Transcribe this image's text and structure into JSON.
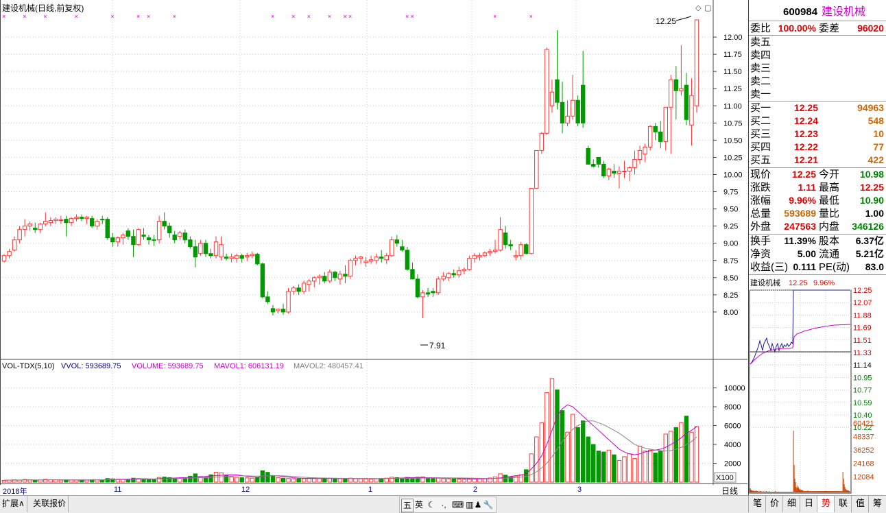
{
  "window": {
    "title": "建设机械(日线,前复权)",
    "right_icons": [
      "◇",
      "▢"
    ]
  },
  "colors": {
    "up": "#ff3232",
    "down": "#009900",
    "vol_label": "#0000ff",
    "volume_label": "#cc00cc",
    "mavol1": "#cc00cc",
    "mavol2": "#808080",
    "bg": "#ffffff",
    "grid": "#c8c8c8"
  },
  "price_axis": {
    "ticks": [
      "12.00",
      "11.75",
      "11.50",
      "11.25",
      "11.00",
      "10.75",
      "10.50",
      "10.25",
      "10.00",
      "9.75",
      "9.50",
      "9.25",
      "9.00",
      "8.75",
      "8.50",
      "8.25",
      "8.00"
    ]
  },
  "annotations": {
    "max_label": "12.25",
    "min_label": "7.91"
  },
  "volume_header": {
    "name": "VOL-TDX(5,10)",
    "vvol": "VVOL: 593689.75",
    "volume": "VOLUME: 593689.75",
    "mavol1": "MAVOL1: 606131.19",
    "mavol2": "MAVOL2: 480457.41"
  },
  "volume_axis": {
    "ticks": [
      "10000",
      "8000",
      "6000",
      "4000",
      "2000"
    ],
    "unit": "X100"
  },
  "date_axis": {
    "labels": [
      "2018年",
      "11",
      "12",
      "1",
      "2",
      "3"
    ],
    "period": "日线"
  },
  "chart_data": {
    "type": "candlestick",
    "ylim": [
      7.6,
      12.3
    ],
    "volume_ylim": [
      0,
      11500
    ],
    "price_series": [
      [
        8.74,
        8.84,
        8.72,
        8.82
      ],
      [
        8.82,
        8.92,
        8.78,
        8.88
      ],
      [
        8.9,
        9.1,
        8.88,
        9.05
      ],
      [
        9.05,
        9.25,
        9.0,
        9.2
      ],
      [
        9.2,
        9.35,
        9.1,
        9.25
      ],
      [
        9.25,
        9.32,
        9.18,
        9.28
      ],
      [
        9.22,
        9.3,
        9.15,
        9.2
      ],
      [
        9.2,
        9.3,
        9.15,
        9.28
      ],
      [
        9.28,
        9.45,
        9.25,
        9.32
      ],
      [
        9.3,
        9.38,
        9.25,
        9.33
      ],
      [
        9.33,
        9.38,
        9.28,
        9.35
      ],
      [
        9.34,
        9.4,
        9.28,
        9.34
      ],
      [
        9.35,
        9.4,
        9.1,
        9.3
      ],
      [
        9.3,
        9.38,
        9.25,
        9.36
      ],
      [
        9.36,
        9.42,
        9.32,
        9.38
      ],
      [
        9.38,
        9.42,
        9.32,
        9.36
      ],
      [
        9.36,
        9.4,
        9.28,
        9.38
      ],
      [
        9.36,
        9.4,
        9.22,
        9.25
      ],
      [
        9.25,
        9.35,
        9.2,
        9.32
      ],
      [
        9.35,
        9.4,
        9.28,
        9.34
      ],
      [
        9.35,
        9.38,
        9.05,
        9.08
      ],
      [
        9.08,
        9.15,
        8.95,
        9.02
      ],
      [
        9.02,
        9.1,
        8.95,
        9.08
      ],
      [
        9.08,
        9.15,
        8.98,
        9.12
      ],
      [
        9.18,
        9.22,
        9.05,
        9.1
      ],
      [
        9.1,
        9.2,
        8.8,
        8.98
      ],
      [
        8.98,
        9.22,
        8.96,
        9.2
      ],
      [
        9.12,
        9.22,
        9.05,
        9.1
      ],
      [
        9.08,
        9.12,
        8.98,
        9.05
      ],
      [
        9.05,
        9.12,
        8.96,
        9.04
      ],
      [
        9.05,
        9.4,
        9.0,
        9.32
      ],
      [
        9.32,
        9.45,
        9.2,
        9.25
      ],
      [
        9.25,
        9.3,
        9.08,
        9.15
      ],
      [
        9.12,
        9.18,
        9.0,
        9.05
      ],
      [
        9.1,
        9.18,
        9.05,
        9.15
      ],
      [
        9.15,
        9.2,
        9.0,
        9.05
      ],
      [
        9.05,
        9.1,
        8.92,
        8.95
      ],
      [
        8.95,
        9.05,
        8.65,
        8.8
      ],
      [
        8.85,
        9.05,
        8.82,
        9.0
      ],
      [
        9.0,
        9.05,
        8.8,
        8.85
      ],
      [
        8.85,
        8.92,
        8.78,
        8.82
      ],
      [
        8.82,
        9.1,
        8.78,
        9.02
      ],
      [
        8.8,
        9.1,
        8.75,
        8.98
      ],
      [
        8.8,
        8.85,
        8.75,
        8.78
      ],
      [
        8.78,
        8.85,
        8.72,
        8.8
      ],
      [
        8.78,
        8.85,
        8.72,
        8.82
      ],
      [
        8.82,
        8.85,
        8.72,
        8.78
      ],
      [
        8.8,
        8.86,
        8.74,
        8.82
      ],
      [
        8.82,
        8.88,
        8.78,
        8.84
      ],
      [
        8.84,
        8.86,
        8.68,
        8.7
      ],
      [
        8.7,
        8.72,
        8.2,
        8.22
      ],
      [
        8.22,
        8.3,
        8.12,
        8.15
      ],
      [
        8.05,
        8.1,
        7.95,
        8.0
      ],
      [
        8.02,
        8.05,
        7.98,
        8.04
      ],
      [
        8.04,
        8.12,
        7.96,
        8.0
      ],
      [
        8.0,
        8.35,
        7.98,
        8.3
      ],
      [
        8.3,
        8.38,
        8.25,
        8.35
      ],
      [
        8.35,
        8.4,
        8.25,
        8.3
      ],
      [
        8.3,
        8.46,
        8.26,
        8.42
      ],
      [
        8.4,
        8.48,
        8.3,
        8.45
      ],
      [
        8.45,
        8.52,
        8.36,
        8.5
      ],
      [
        8.5,
        8.55,
        8.4,
        8.52
      ],
      [
        8.52,
        8.58,
        8.42,
        8.45
      ],
      [
        8.45,
        8.62,
        8.42,
        8.58
      ],
      [
        8.58,
        8.6,
        8.45,
        8.5
      ],
      [
        8.48,
        8.6,
        8.4,
        8.55
      ],
      [
        8.55,
        8.68,
        8.42,
        8.52
      ],
      [
        8.52,
        8.78,
        8.48,
        8.75
      ],
      [
        8.75,
        8.82,
        8.68,
        8.78
      ],
      [
        8.78,
        8.82,
        8.7,
        8.8
      ],
      [
        8.72,
        8.8,
        8.66,
        8.74
      ],
      [
        8.74,
        8.82,
        8.7,
        8.76
      ],
      [
        8.75,
        8.85,
        8.7,
        8.8
      ],
      [
        8.8,
        8.9,
        8.72,
        8.78
      ],
      [
        8.76,
        8.86,
        8.7,
        8.82
      ],
      [
        8.82,
        9.1,
        8.8,
        9.05
      ],
      [
        9.05,
        9.12,
        8.95,
        9.0
      ],
      [
        8.95,
        9.05,
        8.88,
        8.9
      ],
      [
        8.9,
        8.95,
        8.6,
        8.62
      ],
      [
        8.62,
        8.72,
        8.5,
        8.48
      ],
      [
        8.48,
        8.55,
        8.2,
        8.22
      ],
      [
        8.22,
        8.32,
        7.91,
        8.28
      ],
      [
        8.28,
        8.35,
        8.22,
        8.26
      ],
      [
        8.3,
        8.35,
        8.22,
        8.28
      ],
      [
        8.28,
        8.52,
        8.25,
        8.48
      ],
      [
        8.48,
        8.58,
        8.45,
        8.52
      ],
      [
        8.5,
        8.58,
        8.45,
        8.56
      ],
      [
        8.56,
        8.62,
        8.5,
        8.54
      ],
      [
        8.54,
        8.66,
        8.5,
        8.6
      ],
      [
        8.6,
        8.65,
        8.55,
        8.62
      ],
      [
        8.62,
        8.82,
        8.6,
        8.78
      ],
      [
        8.78,
        8.86,
        8.72,
        8.82
      ],
      [
        8.8,
        8.86,
        8.75,
        8.82
      ],
      [
        8.82,
        8.88,
        8.8,
        8.86
      ],
      [
        8.86,
        8.92,
        8.82,
        8.88
      ],
      [
        8.88,
        9.05,
        8.85,
        8.9
      ],
      [
        8.9,
        9.38,
        8.88,
        9.2
      ],
      [
        9.15,
        9.25,
        8.92,
        8.98
      ],
      [
        8.98,
        9.05,
        8.9,
        8.96
      ],
      [
        8.8,
        8.9,
        8.75,
        8.82
      ],
      [
        8.82,
        9.02,
        8.76,
        8.98
      ],
      [
        8.98,
        9.0,
        8.84,
        8.85
      ],
      [
        8.85,
        9.8,
        8.84,
        9.8
      ],
      [
        9.8,
        10.0,
        9.85,
        10.35
      ],
      [
        10.35,
        10.62,
        10.3,
        10.6
      ],
      [
        10.6,
        11.85,
        10.58,
        11.82
      ],
      [
        11.0,
        11.38,
        10.9,
        11.2
      ],
      [
        11.38,
        12.1,
        10.95,
        11.05
      ],
      [
        11.05,
        11.35,
        10.6,
        10.75
      ],
      [
        10.75,
        11.08,
        10.7,
        10.85
      ],
      [
        10.85,
        11.45,
        10.8,
        11.08
      ],
      [
        11.08,
        11.15,
        10.7,
        10.75
      ],
      [
        11.3,
        11.8,
        10.68,
        10.75
      ],
      [
        10.38,
        10.42,
        10.15,
        10.15
      ],
      [
        10.15,
        10.22,
        10.1,
        10.12
      ],
      [
        10.25,
        10.25,
        10.1,
        10.15
      ],
      [
        10.15,
        10.2,
        9.95,
        9.98
      ],
      [
        9.98,
        10.1,
        9.92,
        10.08
      ],
      [
        10.05,
        10.15,
        9.95,
        10.02
      ],
      [
        10.02,
        10.12,
        9.8,
        10.05
      ],
      [
        10.05,
        10.2,
        9.95,
        10.05
      ],
      [
        10.05,
        10.12,
        9.9,
        10.1
      ],
      [
        10.1,
        10.35,
        10.0,
        10.22
      ],
      [
        10.22,
        10.42,
        10.15,
        10.35
      ],
      [
        10.3,
        10.45,
        10.18,
        10.4
      ],
      [
        10.4,
        10.72,
        10.35,
        10.7
      ],
      [
        10.7,
        10.75,
        10.5,
        10.62
      ],
      [
        10.62,
        10.78,
        10.38,
        10.48
      ],
      [
        10.48,
        10.98,
        10.35,
        10.98
      ],
      [
        10.98,
        11.45,
        10.3,
        11.38
      ],
      [
        11.38,
        11.58,
        10.8,
        11.22
      ],
      [
        11.22,
        11.88,
        11.15,
        11.25
      ],
      [
        11.3,
        11.48,
        10.72,
        10.8
      ],
      [
        10.72,
        11.4,
        10.42,
        11.15
      ],
      [
        11.0,
        12.25,
        10.9,
        12.25
      ]
    ],
    "volume_series": [
      180,
      220,
      250,
      200,
      280,
      240,
      200,
      220,
      300,
      260,
      230,
      210,
      250,
      240,
      220,
      200,
      230,
      260,
      250,
      220,
      380,
      350,
      300,
      280,
      320,
      420,
      380,
      330,
      300,
      280,
      500,
      540,
      480,
      420,
      400,
      450,
      620,
      880,
      560,
      500,
      780,
      1050,
      980,
      700,
      540,
      500,
      470,
      450,
      420,
      480,
      1200,
      1040,
      620,
      480,
      420,
      380,
      360,
      350,
      380,
      420,
      400,
      380,
      360,
      400,
      380,
      370,
      390,
      420,
      380,
      360,
      340,
      330,
      350,
      380,
      420,
      520,
      480,
      420,
      500,
      460,
      520,
      560,
      440,
      400,
      420,
      380,
      360,
      340,
      320,
      300,
      330,
      350,
      380,
      400,
      440,
      560,
      880,
      740,
      580,
      640,
      780,
      1320,
      3000,
      4800,
      6300,
      9500,
      11000,
      9800,
      7600,
      5300,
      7200,
      5800,
      6500,
      4800,
      4000,
      3300,
      3200,
      3400,
      2900,
      2300,
      2700,
      3000,
      2500,
      3800,
      3300,
      3400,
      3100,
      3300,
      5100,
      5400,
      5800,
      6300,
      7000,
      5300,
      5900
    ],
    "mavol1": [
      200,
      210,
      220,
      230,
      240,
      250,
      240,
      230,
      240,
      250,
      255,
      250,
      245,
      240,
      235,
      230,
      230,
      235,
      240,
      245,
      260,
      280,
      300,
      310,
      320,
      340,
      350,
      360,
      350,
      340,
      370,
      400,
      420,
      440,
      460,
      470,
      490,
      560,
      590,
      600,
      650,
      700,
      730,
      760,
      770,
      760,
      700,
      620,
      560,
      510,
      600,
      680,
      700,
      660,
      600,
      540,
      460,
      430,
      400,
      390,
      385,
      385,
      385,
      385,
      385,
      385,
      385,
      385,
      385,
      385,
      380,
      375,
      370,
      370,
      380,
      400,
      420,
      440,
      460,
      480,
      480,
      480,
      475,
      470,
      460,
      450,
      440,
      420,
      400,
      380,
      360,
      350,
      355,
      360,
      370,
      400,
      450,
      520,
      600,
      690,
      740,
      900,
      1400,
      2000,
      2800,
      4000,
      5500,
      7000,
      7800,
      8200,
      8000,
      7500,
      7000,
      6500,
      6000,
      5500,
      5000,
      4500,
      4000,
      3500,
      3200,
      3000,
      2900,
      3000,
      3200,
      3300,
      3400,
      3500,
      3700,
      4000,
      4300,
      4700,
      5200,
      5500,
      5900
    ],
    "mavol2": [
      200,
      205,
      210,
      215,
      220,
      225,
      230,
      235,
      240,
      245,
      250,
      250,
      250,
      250,
      248,
      245,
      242,
      240,
      240,
      240,
      245,
      255,
      265,
      275,
      285,
      295,
      305,
      315,
      320,
      325,
      335,
      350,
      365,
      380,
      395,
      410,
      425,
      450,
      470,
      490,
      510,
      540,
      570,
      600,
      630,
      660,
      660,
      660,
      650,
      640,
      650,
      660,
      670,
      680,
      660,
      640,
      600,
      560,
      520,
      480,
      460,
      450,
      440,
      430,
      420,
      410,
      400,
      395,
      390,
      388,
      386,
      384,
      382,
      380,
      380,
      382,
      385,
      390,
      400,
      410,
      420,
      430,
      440,
      445,
      450,
      455,
      455,
      450,
      445,
      440,
      430,
      420,
      410,
      400,
      390,
      390,
      400,
      420,
      450,
      490,
      530,
      600,
      800,
      1100,
      1500,
      2000,
      2700,
      3500,
      4300,
      5000,
      5600,
      6000,
      6300,
      6500,
      6500,
      6300,
      6100,
      5800,
      5500,
      5200,
      4800,
      4400,
      4000,
      3800,
      3600,
      3500,
      3400,
      3350,
      3300,
      3350,
      3500,
      3700,
      4000,
      4300,
      4800
    ],
    "markers_x": [
      0,
      4,
      8,
      14,
      21,
      26,
      28,
      33,
      52,
      56,
      59,
      63,
      66,
      67,
      78,
      79,
      95,
      102
    ]
  },
  "quote": {
    "code": "600984",
    "name": "建设机械",
    "weibi_label": "委比",
    "weibi": "100.00%",
    "weicha_label": "委差",
    "weicha": "96020",
    "sells": [
      {
        "label": "卖五",
        "price": "",
        "vol": ""
      },
      {
        "label": "卖四",
        "price": "",
        "vol": ""
      },
      {
        "label": "卖三",
        "price": "",
        "vol": ""
      },
      {
        "label": "卖二",
        "price": "",
        "vol": ""
      },
      {
        "label": "卖一",
        "price": "",
        "vol": ""
      }
    ],
    "buys": [
      {
        "label": "买一",
        "price": "12.25",
        "vol": "94963"
      },
      {
        "label": "买二",
        "price": "12.24",
        "vol": "548"
      },
      {
        "label": "买三",
        "price": "12.23",
        "vol": "10"
      },
      {
        "label": "买四",
        "price": "12.22",
        "vol": "77"
      },
      {
        "label": "买五",
        "price": "12.21",
        "vol": "422"
      }
    ],
    "stats": [
      {
        "l1": "现价",
        "v1": "12.25",
        "c1": "#e00000",
        "l2": "今开",
        "v2": "10.98",
        "c2": "#008000"
      },
      {
        "l1": "涨跌",
        "v1": "1.11",
        "c1": "#e00000",
        "l2": "最高",
        "v2": "12.25",
        "c2": "#e00000"
      },
      {
        "l1": "涨幅",
        "v1": "9.96%",
        "c1": "#e00000",
        "l2": "最低",
        "v2": "10.90",
        "c2": "#008000"
      },
      {
        "l1": "总量",
        "v1": "593689",
        "c1": "#cc6600",
        "l2": "量比",
        "v2": "1.00",
        "c2": "#000000"
      },
      {
        "l1": "外盘",
        "v1": "247563",
        "c1": "#e00000",
        "l2": "内盘",
        "v2": "346126",
        "c2": "#008000"
      }
    ],
    "stats2": [
      {
        "l1": "换手",
        "v1": "11.39%",
        "l2": "股本",
        "v2": "6.37亿"
      },
      {
        "l1": "净资",
        "v1": "5.00",
        "l2": "流通",
        "v2": "5.21亿"
      },
      {
        "l1": "收益(三)",
        "v1": "0.111",
        "l2": "PE(动)",
        "v2": "83.0"
      }
    ]
  },
  "mini_chart": {
    "title": "建设机械",
    "price": "12.25",
    "change": "9.96%",
    "price_ticks": [
      "12.25",
      "12.07",
      "11.88",
      "11.69",
      "11.51",
      "11.33",
      "11.14",
      "10.95",
      "10.77",
      "10.59",
      "10.40",
      "10.22"
    ],
    "vol_ticks": [
      "60421",
      "48337",
      "36252",
      "24168",
      "12084"
    ]
  },
  "bottom_bar": {
    "left_tabs": [
      "扩展∧",
      "关联报价"
    ],
    "center_tools": [
      "五",
      "英",
      "☾",
      "·,",
      "⌨",
      "▥",
      "♟",
      "🔧"
    ],
    "right_tabs": [
      "笔",
      "价",
      "细",
      "日",
      "势",
      "联",
      "值",
      "筹"
    ]
  }
}
